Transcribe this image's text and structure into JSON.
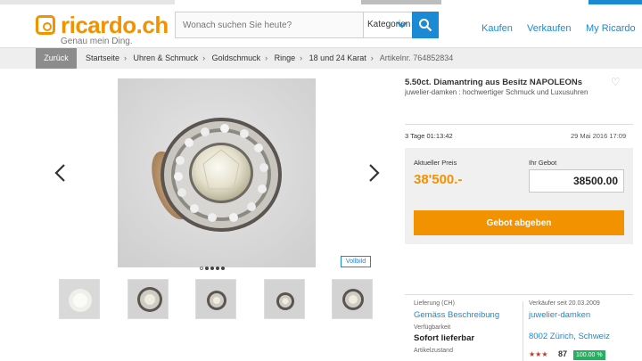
{
  "header": {
    "logo_text": "ricardo.ch",
    "tagline": "Genau mein Ding.",
    "search_placeholder": "Wonach suchen Sie heute?",
    "category_label": "Kategorien",
    "nav": [
      "Kaufen",
      "Verkaufen",
      "My Ricardo"
    ]
  },
  "breadcrumb": {
    "back_label": "Zurück",
    "items": [
      "Startseite",
      "Uhren & Schmuck",
      "Goldschmuck",
      "Ringe",
      "18 und 24 Karat"
    ],
    "article_no": "Artikelnr. 764852834"
  },
  "gallery": {
    "fullscreen_label": "Vollbild",
    "thumbnail_count": 5,
    "dot_count": 5,
    "active_dot": 1
  },
  "listing": {
    "title": "5.50ct. Diamantring aus Besitz NAPOLEONs",
    "seller_line": "juwelier-damken : hochwertiger Schmuck und Luxusuhren",
    "time_left": "3 Tage 01:13:42",
    "end_date": "29 Mai 2016 17:09",
    "current_price_label": "Aktueller Preis",
    "current_price": "38'500.-",
    "your_bid_label": "Ihr Gebot",
    "your_bid_value": "38500.00",
    "bid_button": "Gebot abgeben"
  },
  "details": {
    "delivery_label": "Lieferung (CH)",
    "delivery_value": "Gemäss Beschreibung",
    "availability_label": "Verfügbarkeit",
    "availability_value": "Sofort lieferbar",
    "condition_label": "Artikelzustand",
    "seller_since_label": "Verkäufer seit 20.03.2009",
    "seller_name": "juwelier-damken",
    "seller_location": "8002 Zürich, Schweiz",
    "rating_stars": "★★★",
    "rating_score": "87",
    "rating_percent": "100.00 %"
  },
  "colors": {
    "brand_orange": "#f39200",
    "link_blue": "#1a8ad5",
    "rating_green": "#27ae60"
  }
}
